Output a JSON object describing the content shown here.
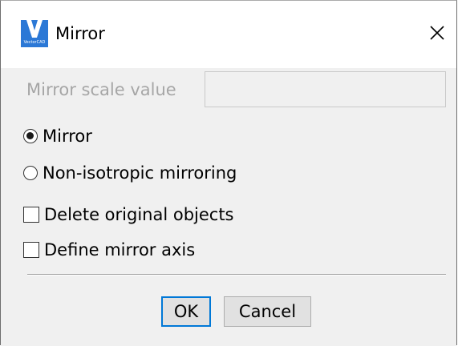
{
  "window": {
    "title": "Mirror",
    "logo_caption": "VectorCAD",
    "close_glyph": "✕",
    "accent_color": "#0078d7"
  },
  "scale": {
    "label": "Mirror scale value",
    "value": ""
  },
  "options": {
    "mirror": {
      "label": "Mirror",
      "checked": true
    },
    "non_isotropic": {
      "label": "Non-isotropic mirroring",
      "checked": false
    },
    "delete_original": {
      "label": "Delete original objects",
      "checked": false
    },
    "define_axis": {
      "label": "Define mirror axis",
      "checked": false
    }
  },
  "buttons": {
    "ok_label": "OK",
    "cancel_label": "Cancel"
  }
}
